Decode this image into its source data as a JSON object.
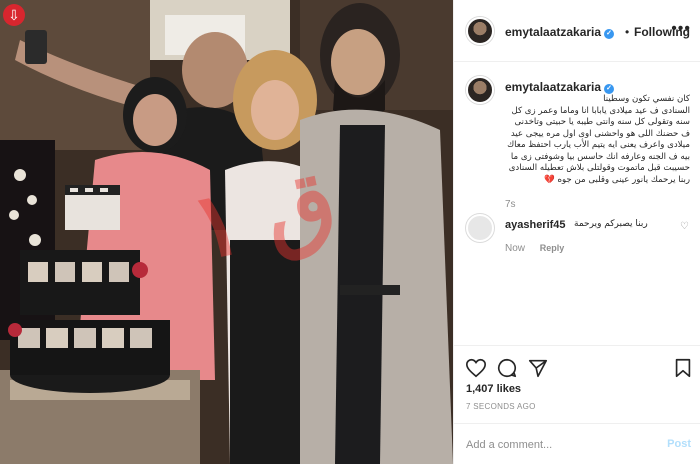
{
  "post": {
    "download_icon": "down-arrow-icon",
    "watermark_color": "#e8342e"
  },
  "header": {
    "username": "emytalaatzakaria",
    "separator": "•",
    "follow_label": "Following",
    "more_icon": "ellipsis-icon"
  },
  "caption": {
    "username": "emytalaatzakaria",
    "lines": [
      "كان نفسي تكون وسطينا",
      "السنادى ف عيد ميلادى يابابا انا وماما وعمر زى كل",
      "سنه وتقولى كل سنه وانتى طيبه يا حبيتى وتاخدنى",
      "ف حضنك اللى هو واحشنى اوى اول مره ييجى عيد",
      "ميلادى واعرف يعنى ايه يتيم الأب يارب احتفظ معاك",
      "بيه ف الجنه وعارفه انك حاسس بيا وشوفتى زى ما",
      "حسيبت قبل ماتموت وقولتلى بلاش تعطيله السنادى",
      "ربنا يرحمك يانور عينى وقلبى من جوه 💔"
    ],
    "time": "7s"
  },
  "comment": {
    "username": "ayasherif45",
    "text": "ربنا يصبركم ويرحمة",
    "time": "Now",
    "reply_label": "Reply"
  },
  "actions": {
    "likes": "1,407 likes",
    "posted": "7 SECONDS AGO"
  },
  "add_comment": {
    "placeholder": "Add a comment...",
    "post_label": "Post"
  }
}
